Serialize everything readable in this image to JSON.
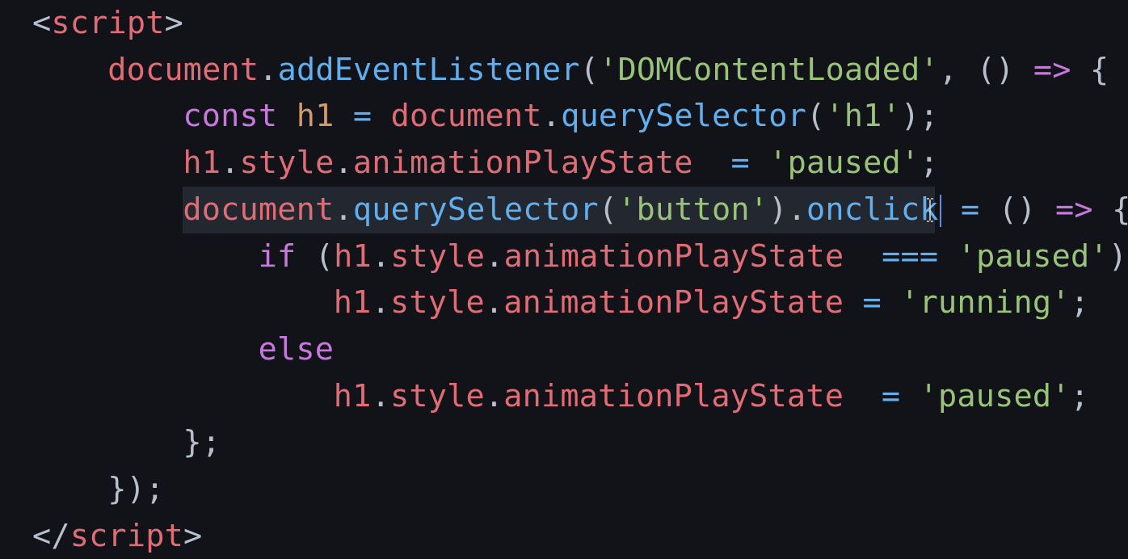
{
  "colors": {
    "background": "#111319",
    "active_line": "#23272f",
    "punctuation": "#b8bfcc",
    "tag": "#e06c75",
    "variable": "#e06c75",
    "function": "#61afef",
    "string": "#98c379",
    "keyword": "#c678dd",
    "constant": "#d19a66",
    "caret": "#5c8ee8"
  },
  "lines": [
    {
      "indent": 0,
      "tokens": [
        {
          "text": "<",
          "type": "punctuation"
        },
        {
          "text": "script",
          "type": "tag"
        },
        {
          "text": ">",
          "type": "punctuation"
        }
      ]
    },
    {
      "indent": 2,
      "tokens": [
        {
          "text": "document",
          "type": "variable"
        },
        {
          "text": ".",
          "type": "punctuation"
        },
        {
          "text": "addEventListener",
          "type": "function"
        },
        {
          "text": "(",
          "type": "punctuation"
        },
        {
          "text": "'DOMContentLoaded'",
          "type": "string"
        },
        {
          "text": ", () ",
          "type": "punctuation"
        },
        {
          "text": "=>",
          "type": "keyword"
        },
        {
          "text": " {",
          "type": "punctuation"
        }
      ]
    },
    {
      "indent": 4,
      "tokens": [
        {
          "text": "const",
          "type": "keyword"
        },
        {
          "text": " ",
          "type": "punctuation"
        },
        {
          "text": "h1",
          "type": "constant"
        },
        {
          "text": " ",
          "type": "punctuation"
        },
        {
          "text": "=",
          "type": "function"
        },
        {
          "text": " ",
          "type": "punctuation"
        },
        {
          "text": "document",
          "type": "variable"
        },
        {
          "text": ".",
          "type": "punctuation"
        },
        {
          "text": "querySelector",
          "type": "function"
        },
        {
          "text": "(",
          "type": "punctuation"
        },
        {
          "text": "'h1'",
          "type": "string"
        },
        {
          "text": ");",
          "type": "punctuation"
        }
      ]
    },
    {
      "indent": 4,
      "tokens": [
        {
          "text": "h1",
          "type": "variable"
        },
        {
          "text": ".",
          "type": "punctuation"
        },
        {
          "text": "style",
          "type": "variable"
        },
        {
          "text": ".",
          "type": "punctuation"
        },
        {
          "text": "animationPlayState",
          "type": "variable"
        },
        {
          "text": "  ",
          "type": "punctuation"
        },
        {
          "text": "=",
          "type": "function"
        },
        {
          "text": " ",
          "type": "punctuation"
        },
        {
          "text": "'paused'",
          "type": "string"
        },
        {
          "text": ";",
          "type": "punctuation"
        }
      ]
    },
    {
      "indent": 4,
      "active": true,
      "tokens": [
        {
          "text": "document",
          "type": "variable"
        },
        {
          "text": ".",
          "type": "punctuation"
        },
        {
          "text": "querySelector",
          "type": "function"
        },
        {
          "text": "(",
          "type": "punctuation"
        },
        {
          "text": "'button'",
          "type": "string"
        },
        {
          "text": ").",
          "type": "punctuation"
        },
        {
          "text": "onclick",
          "type": "function",
          "caret_after": true
        },
        {
          "text": " ",
          "type": "punctuation"
        },
        {
          "text": "=",
          "type": "function"
        },
        {
          "text": " () ",
          "type": "punctuation"
        },
        {
          "text": "=>",
          "type": "keyword"
        },
        {
          "text": " {",
          "type": "punctuation"
        }
      ]
    },
    {
      "indent": 6,
      "tokens": [
        {
          "text": "if",
          "type": "keyword"
        },
        {
          "text": " (",
          "type": "punctuation"
        },
        {
          "text": "h1",
          "type": "variable"
        },
        {
          "text": ".",
          "type": "punctuation"
        },
        {
          "text": "style",
          "type": "variable"
        },
        {
          "text": ".",
          "type": "punctuation"
        },
        {
          "text": "animationPlayState",
          "type": "variable"
        },
        {
          "text": "  ",
          "type": "punctuation"
        },
        {
          "text": "===",
          "type": "function"
        },
        {
          "text": " ",
          "type": "punctuation"
        },
        {
          "text": "'paused'",
          "type": "string"
        },
        {
          "text": ")",
          "type": "punctuation"
        }
      ]
    },
    {
      "indent": 8,
      "tokens": [
        {
          "text": "h1",
          "type": "variable"
        },
        {
          "text": ".",
          "type": "punctuation"
        },
        {
          "text": "style",
          "type": "variable"
        },
        {
          "text": ".",
          "type": "punctuation"
        },
        {
          "text": "animationPlayState",
          "type": "variable"
        },
        {
          "text": " ",
          "type": "punctuation"
        },
        {
          "text": "=",
          "type": "function"
        },
        {
          "text": " ",
          "type": "punctuation"
        },
        {
          "text": "'running'",
          "type": "string"
        },
        {
          "text": ";",
          "type": "punctuation"
        }
      ]
    },
    {
      "indent": 6,
      "tokens": [
        {
          "text": "else",
          "type": "keyword"
        }
      ]
    },
    {
      "indent": 8,
      "tokens": [
        {
          "text": "h1",
          "type": "variable"
        },
        {
          "text": ".",
          "type": "punctuation"
        },
        {
          "text": "style",
          "type": "variable"
        },
        {
          "text": ".",
          "type": "punctuation"
        },
        {
          "text": "animationPlayState",
          "type": "variable"
        },
        {
          "text": "  ",
          "type": "punctuation"
        },
        {
          "text": "=",
          "type": "function"
        },
        {
          "text": " ",
          "type": "punctuation"
        },
        {
          "text": "'paused'",
          "type": "string"
        },
        {
          "text": ";",
          "type": "punctuation"
        }
      ]
    },
    {
      "indent": 4,
      "tokens": [
        {
          "text": "};",
          "type": "punctuation"
        }
      ]
    },
    {
      "indent": 2,
      "tokens": [
        {
          "text": "});",
          "type": "punctuation"
        }
      ]
    },
    {
      "indent": 0,
      "tokens": [
        {
          "text": "</",
          "type": "punctuation"
        },
        {
          "text": "script",
          "type": "tag"
        },
        {
          "text": ">",
          "type": "punctuation"
        }
      ]
    }
  ]
}
